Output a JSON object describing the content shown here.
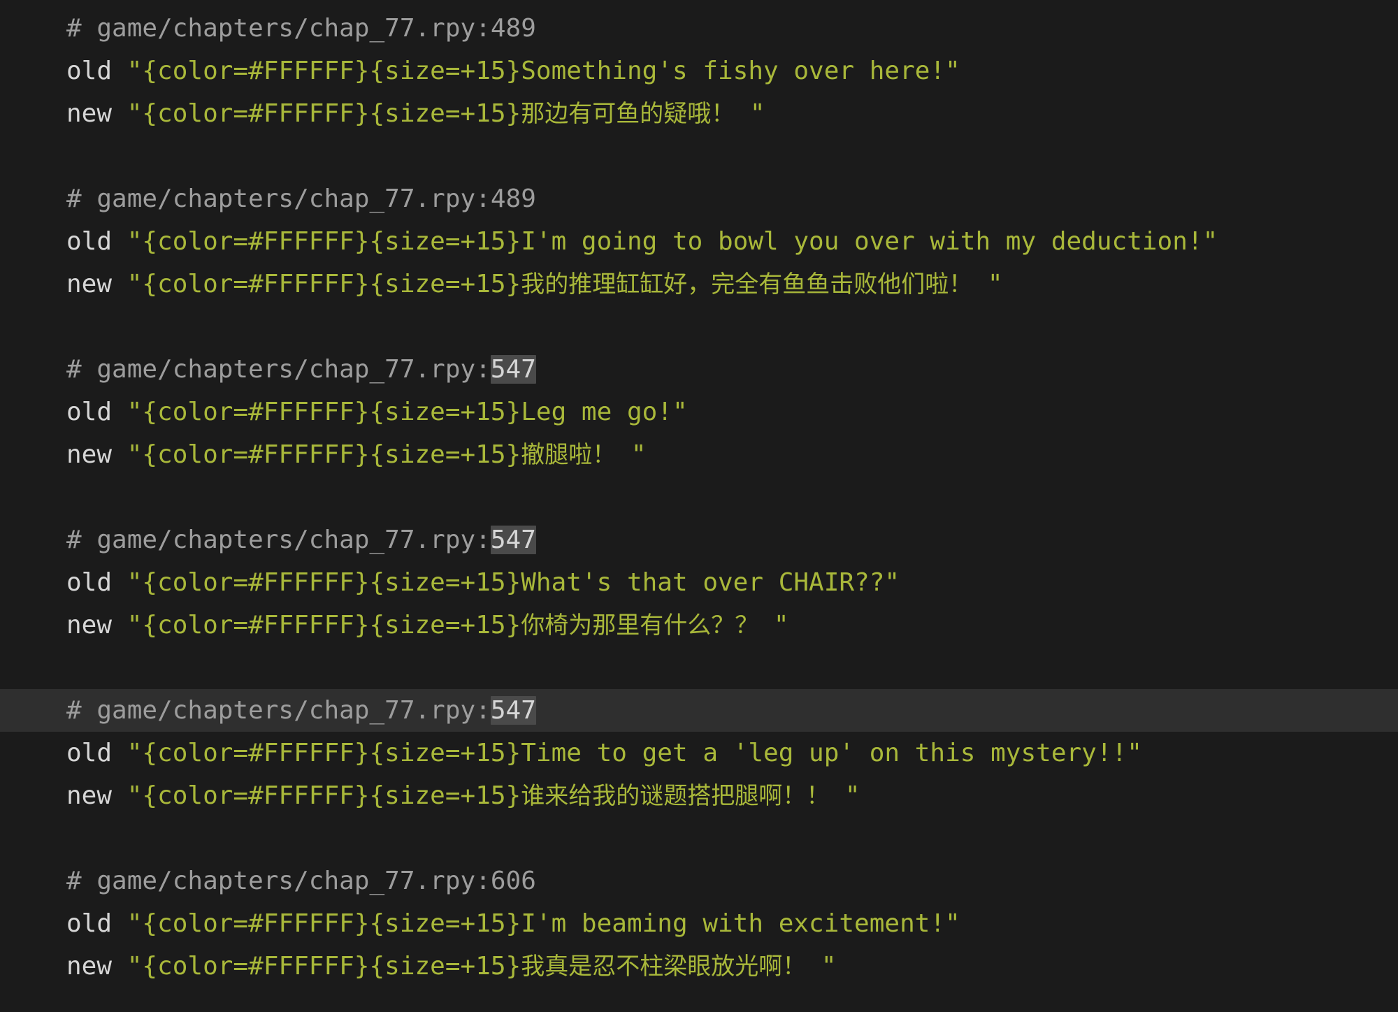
{
  "editor": {
    "type": "code-editor",
    "language": "renpy-translation",
    "background_color": "#1b1b1b",
    "current_line_highlight_color": "#2f2f2f",
    "search_match_highlight_color": "#4a4a4a",
    "comment_color": "#9d9d9d",
    "keyword_color": "#d6d6d6",
    "string_color": "#a9b83a",
    "search_term": "547",
    "prefix_tag": "\"{color=#FFFFFF}{size=+15}",
    "suffix_tag": "\"",
    "keywords": {
      "old": "old",
      "new": "new"
    }
  },
  "blocks": [
    {
      "comment_prefix": "# game/chapters/chap_77.rpy:",
      "comment_line_number": "489",
      "comment_highlighted": false,
      "current": false,
      "old_text": "Something's fishy over here!",
      "new_text": "那边有可鱼的疑哦！"
    },
    {
      "comment_prefix": "# game/chapters/chap_77.rpy:",
      "comment_line_number": "489",
      "comment_highlighted": false,
      "current": false,
      "old_text": "I'm going to bowl you over with my deduction!",
      "new_text": "我的推理缸缸好，完全有鱼鱼击败他们啦！"
    },
    {
      "comment_prefix": "# game/chapters/chap_77.rpy:",
      "comment_line_number": "547",
      "comment_highlighted": true,
      "current": false,
      "old_text": "Leg me go!",
      "new_text": "撤腿啦！"
    },
    {
      "comment_prefix": "# game/chapters/chap_77.rpy:",
      "comment_line_number": "547",
      "comment_highlighted": true,
      "current": false,
      "old_text": "What's that over CHAIR??",
      "new_text": "你椅为那里有什么？？"
    },
    {
      "comment_prefix": "# game/chapters/chap_77.rpy:",
      "comment_line_number": "547",
      "comment_highlighted": true,
      "current": true,
      "old_text": "Time to get a 'leg up' on this mystery!!",
      "new_text": "谁来给我的谜题搭把腿啊！！"
    },
    {
      "comment_prefix": "# game/chapters/chap_77.rpy:",
      "comment_line_number": "606",
      "comment_highlighted": false,
      "current": false,
      "old_text": "I'm beaming with excitement!",
      "new_text": "我真是忍不柱梁眼放光啊！"
    }
  ]
}
